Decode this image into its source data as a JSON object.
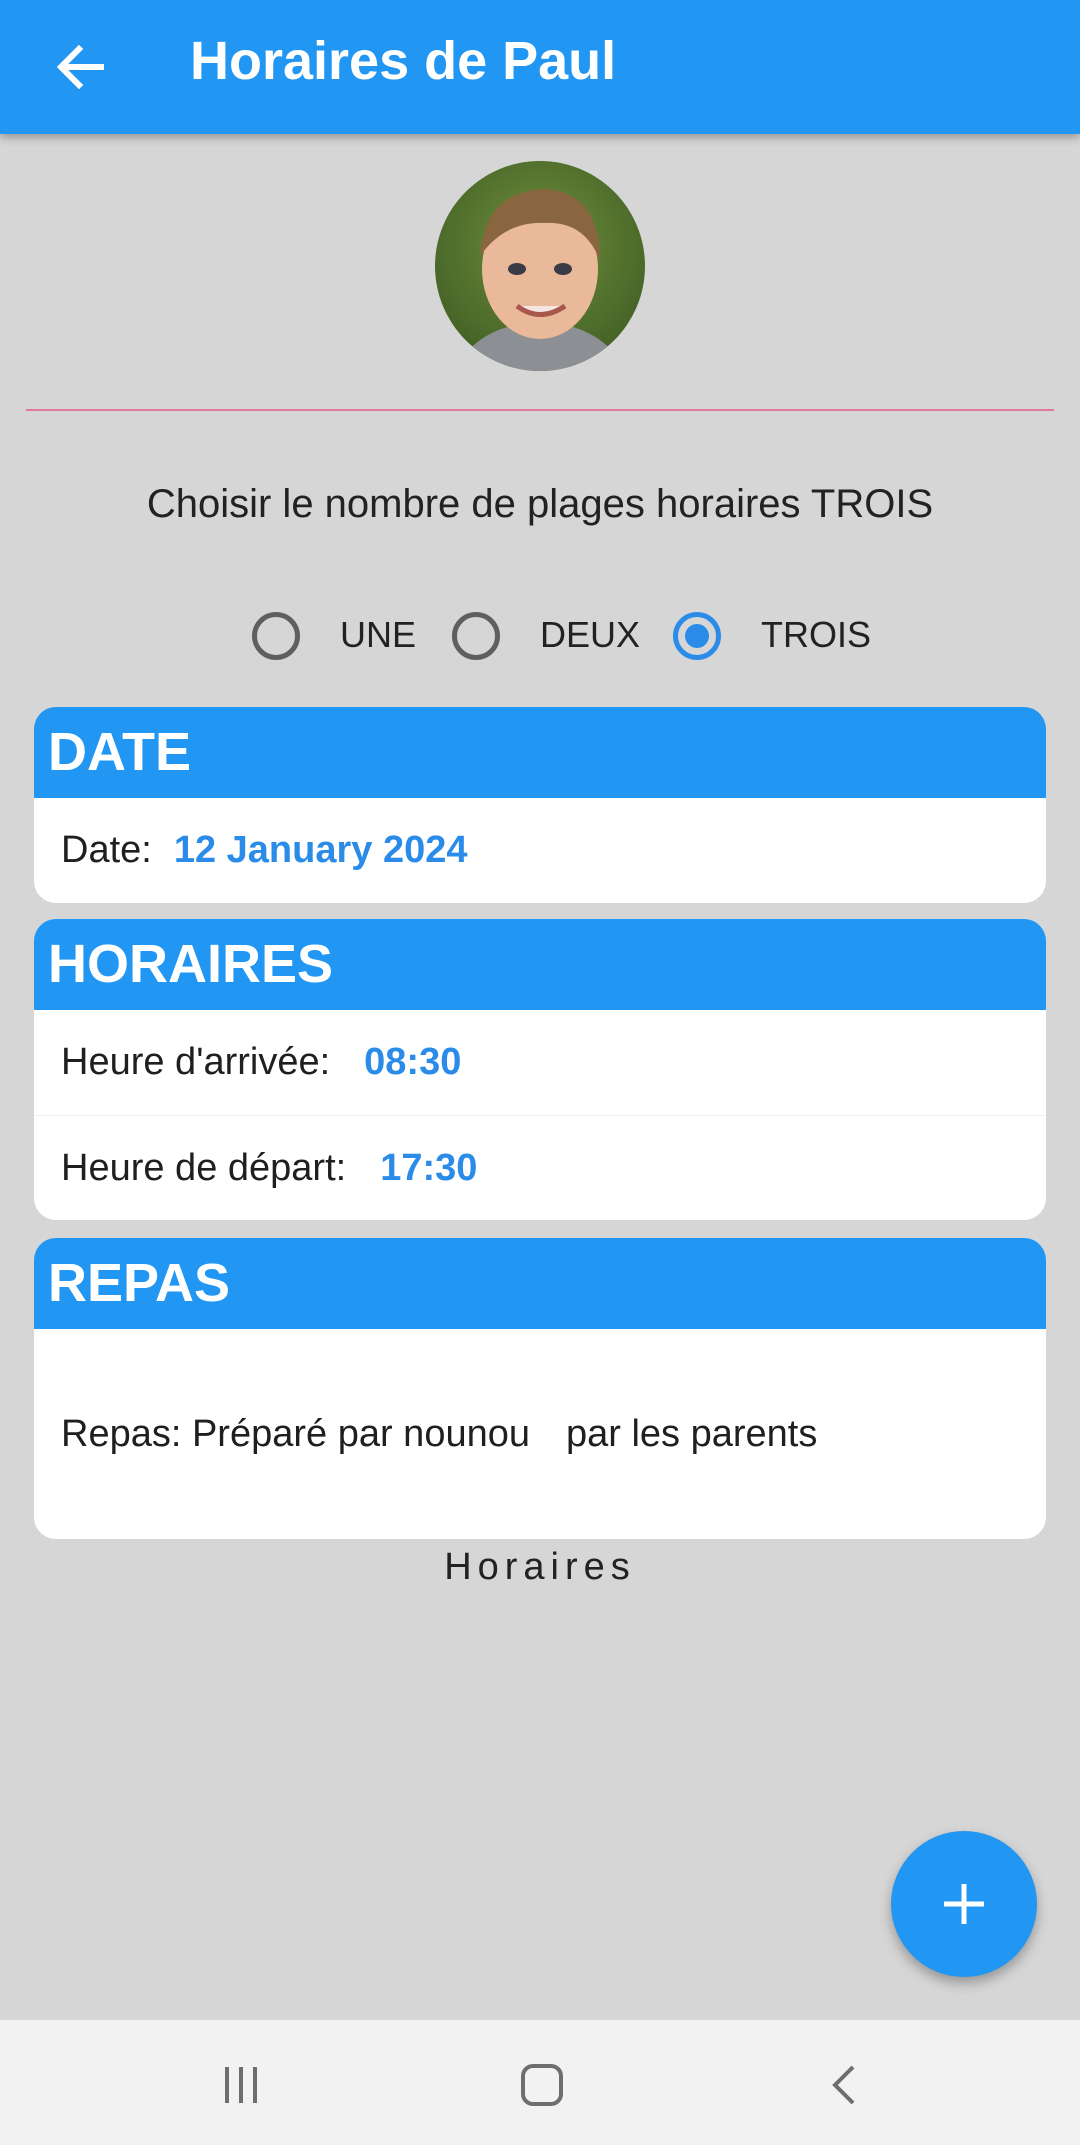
{
  "appbar": {
    "title": "Horaires de Paul"
  },
  "selector": {
    "prompt": "Choisir le nombre de plages horaires TROIS",
    "options": [
      {
        "label": "UNE",
        "checked": false
      },
      {
        "label": "DEUX",
        "checked": false
      },
      {
        "label": "TROIS",
        "checked": true
      }
    ]
  },
  "date_card": {
    "header": "DATE",
    "label": "Date:",
    "value": "12 January 2024"
  },
  "horaires_card": {
    "header": "HORAIRES",
    "arrival_label": "Heure d'arrivée:",
    "arrival_value": "08:30",
    "departure_label": "Heure de départ:",
    "departure_value": "17:30"
  },
  "repas_card": {
    "header": "REPAS",
    "text": "Repas: Préparé par nounou",
    "text2": "par les parents"
  },
  "footer": {
    "label": "Horaires"
  },
  "colors": {
    "primary": "#2196f3",
    "value_text": "#2a8ce8",
    "background": "#d6d6d6"
  }
}
